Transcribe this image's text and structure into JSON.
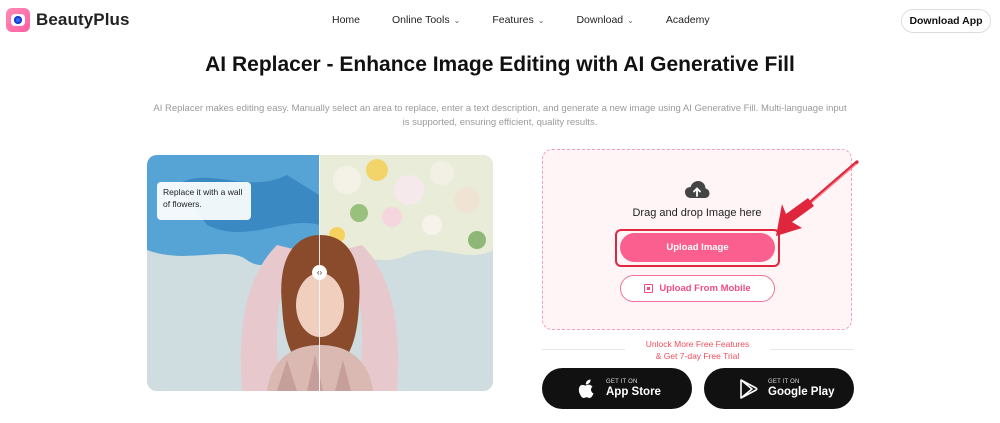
{
  "brand": {
    "name": "BeautyPlus"
  },
  "nav": {
    "items": [
      {
        "label": "Home",
        "dropdown": false
      },
      {
        "label": "Online Tools",
        "dropdown": true
      },
      {
        "label": "Features",
        "dropdown": true
      },
      {
        "label": "Download",
        "dropdown": true
      },
      {
        "label": "Academy",
        "dropdown": false
      }
    ],
    "download_app": "Download App"
  },
  "hero": {
    "title": "AI Replacer - Enhance Image Editing with AI Generative Fill",
    "subtitle": "AI Replacer makes editing easy. Manually select an area to replace, enter a text description, and generate a new image using AI Generative Fill. Multi-language input is supported, ensuring efficient, quality results."
  },
  "preview": {
    "prompt_text": "Replace it with a wall of flowers.",
    "handle_glyph": "‹›"
  },
  "upload": {
    "drag_text": "Drag and drop Image here",
    "upload_button": "Upload Image",
    "mobile_button": "Upload From Mobile",
    "icon": "cloud-upload-icon"
  },
  "trial": {
    "line1": "Unlock More Free Features",
    "line2": "& Get 7-day Free Trial"
  },
  "stores": [
    {
      "small": "GET IT ON",
      "big": "App Store",
      "icon": "apple-icon"
    },
    {
      "small": "GET IT ON",
      "big": "Google Play",
      "icon": "google-play-icon"
    }
  ],
  "colors": {
    "accent_pink": "#fb5f8f",
    "highlight_red": "#e0263d",
    "trial_red": "#ef4f5e",
    "upload_bg": "#fff5f7"
  }
}
